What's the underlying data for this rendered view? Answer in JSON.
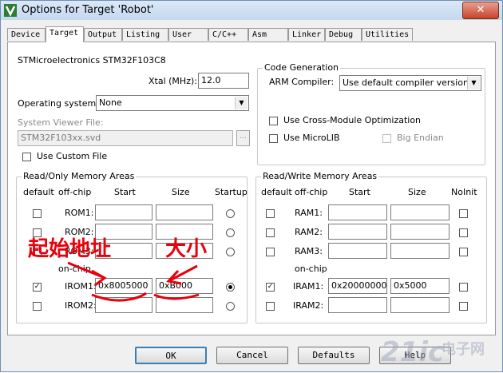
{
  "window": {
    "title": "Options for Target 'Robot'",
    "close_label": "✕"
  },
  "tabs": [
    {
      "label": "Device"
    },
    {
      "label": "Target"
    },
    {
      "label": "Output"
    },
    {
      "label": "Listing"
    },
    {
      "label": "User"
    },
    {
      "label": "C/C++"
    },
    {
      "label": "Asm"
    },
    {
      "label": "Linker"
    },
    {
      "label": "Debug"
    },
    {
      "label": "Utilities"
    }
  ],
  "target": {
    "device_name": "STMicroelectronics STM32F103C8",
    "xtal_label": "Xtal (MHz):",
    "xtal_value": "12.0",
    "os_label": "Operating system:",
    "os_value": "None",
    "svd_label": "System Viewer File:",
    "svd_value": "STM32F103xx.svd",
    "browse_label": "...",
    "custom_file_label": "Use Custom File"
  },
  "codegen": {
    "title": "Code Generation",
    "arm_compiler_label": "ARM Compiler:",
    "arm_compiler_value": "Use default compiler version",
    "cross_module_label": "Use Cross-Module Optimization",
    "microlib_label": "Use MicroLIB",
    "big_endian_label": "Big Endian"
  },
  "ro_memory": {
    "title": "Read/Only Memory Areas",
    "headers": {
      "default": "default",
      "offchip": "off-chip",
      "start": "Start",
      "size": "Size",
      "startup": "Startup"
    },
    "onchip_label": "on-chip",
    "rows": [
      {
        "name": "ROM1:",
        "start": "",
        "size": ""
      },
      {
        "name": "ROM2:",
        "start": "",
        "size": ""
      },
      {
        "name": "ROM3:",
        "start": "",
        "size": ""
      },
      {
        "name": "IROM1:",
        "start": "0x8005000",
        "size": "0xB000"
      },
      {
        "name": "IROM2:",
        "start": "",
        "size": ""
      }
    ]
  },
  "rw_memory": {
    "title": "Read/Write Memory Areas",
    "headers": {
      "default": "default",
      "offchip": "off-chip",
      "start": "Start",
      "size": "Size",
      "noinit": "NoInit"
    },
    "onchip_label": "on-chip",
    "rows": [
      {
        "name": "RAM1:",
        "start": "",
        "size": ""
      },
      {
        "name": "RAM2:",
        "start": "",
        "size": ""
      },
      {
        "name": "RAM3:",
        "start": "",
        "size": ""
      },
      {
        "name": "IRAM1:",
        "start": "0x20000000",
        "size": "0x5000"
      },
      {
        "name": "IRAM2:",
        "start": "",
        "size": ""
      }
    ]
  },
  "buttons": {
    "ok": "OK",
    "cancel": "Cancel",
    "defaults": "Defaults",
    "help": "Help"
  },
  "annotations": {
    "start_address": "起始地址",
    "size": "大小"
  },
  "watermark": {
    "text": "21ic",
    "sub": "电子网"
  },
  "colors": {
    "annotation_red": "#e8000b",
    "accent": "#3c7fb1"
  }
}
